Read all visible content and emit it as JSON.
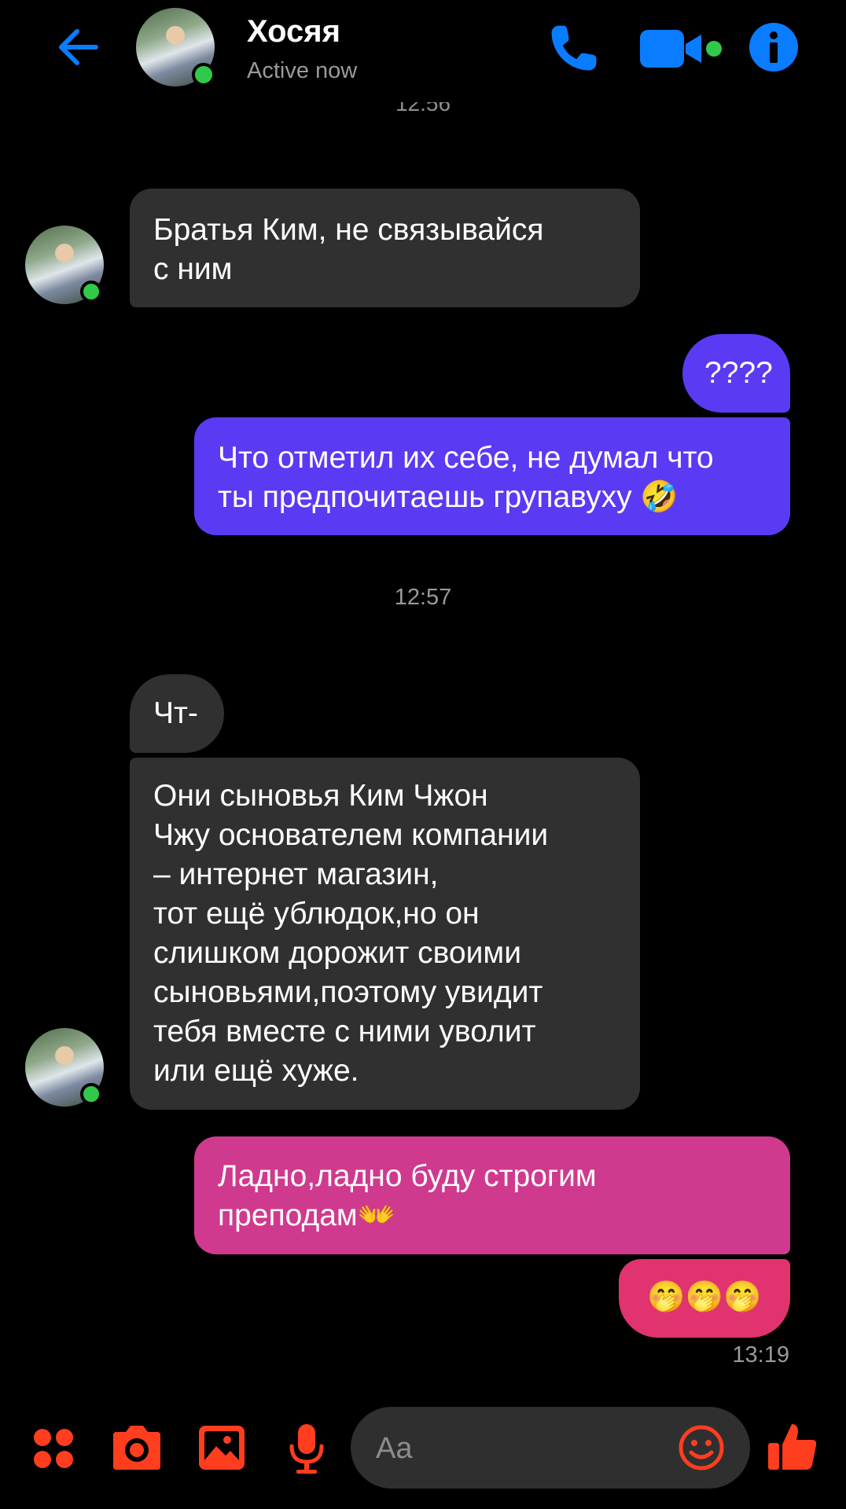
{
  "header": {
    "contact_name": "Хосяя",
    "contact_status": "Active now"
  },
  "partial_timestamp": "12:56",
  "messages": [
    {
      "side": "incoming",
      "text": "Братья Ким, не связывайся\nс ним"
    },
    {
      "side": "outgoing",
      "text": "????"
    },
    {
      "side": "outgoing",
      "text": "Что отметил их себе, не думал что\nты предпочитаешь групавуху 🤣"
    },
    {
      "type": "timestamp",
      "text": "12:57"
    },
    {
      "side": "incoming",
      "text": "Чт-"
    },
    {
      "side": "incoming",
      "text": "Они сыновья Ким Чжон\nЧжу основателем компании\n– интернет магазин,\nтот ещё ублюдок,но  он\nслишком дорожит своими\nсыновьями,поэтому увидит\nтебя вместе с ними уволит\nили ещё хуже."
    },
    {
      "side": "outgoing",
      "text": "Ладно,ладно буду строгим\nпреподам👐"
    },
    {
      "side": "outgoing",
      "text": "🤭🤭🤭"
    },
    {
      "type": "timestamp",
      "text": "13:19"
    }
  ],
  "composer": {
    "placeholder": "Aa"
  },
  "colors": {
    "accent_blue": "#0a7cff",
    "accent_orange": "#ff3d1f",
    "bubble_incoming": "#303030",
    "bubble_outgoing_blue": "#5b3af3",
    "bubble_outgoing_pink": "#cf3a8e",
    "online_green": "#31c94a"
  },
  "icons": [
    "back-arrow-icon",
    "phone-icon",
    "video-camera-icon",
    "info-icon",
    "apps-grid-icon",
    "camera-icon",
    "image-icon",
    "microphone-icon",
    "emoji-icon",
    "thumbs-up-icon"
  ]
}
